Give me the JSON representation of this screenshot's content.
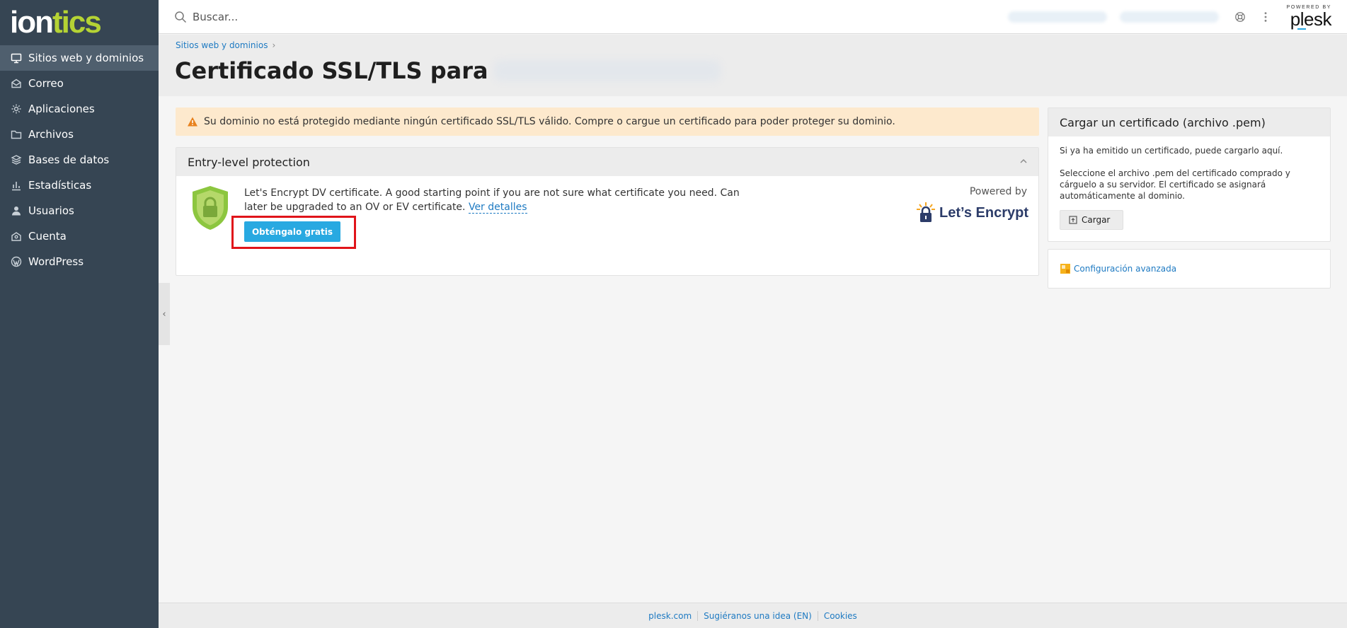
{
  "logo": {
    "part1": "ion",
    "part2": "tics"
  },
  "sidebar": {
    "items": [
      {
        "label": "Sitios web y dominios",
        "icon": "monitor-icon",
        "active": true
      },
      {
        "label": "Correo",
        "icon": "mail-icon"
      },
      {
        "label": "Aplicaciones",
        "icon": "gear-icon"
      },
      {
        "label": "Archivos",
        "icon": "folder-icon"
      },
      {
        "label": "Bases de datos",
        "icon": "database-icon"
      },
      {
        "label": "Estadísticas",
        "icon": "bar-chart-icon"
      },
      {
        "label": "Usuarios",
        "icon": "user-icon"
      },
      {
        "label": "Cuenta",
        "icon": "account-icon"
      },
      {
        "label": "WordPress",
        "icon": "wordpress-icon"
      }
    ],
    "collapse_glyph": "‹"
  },
  "topbar": {
    "search_placeholder": "Buscar...",
    "plesk_powered": "POWERED BY",
    "plesk_brand": "plesk"
  },
  "header": {
    "breadcrumb": "Sitios web y dominios",
    "breadcrumb_sep": "›",
    "title": "Certificado SSL/TLS para"
  },
  "warning": {
    "text": "Su dominio no está protegido mediante ningún certificado SSL/TLS válido. Compre o cargue un certificado para poder proteger su dominio."
  },
  "entry_panel": {
    "title": "Entry-level protection",
    "description": "Let's Encrypt DV certificate. A good starting point if you are not sure what certificate you need. Can later be upgraded to an OV or EV certificate.",
    "details_link": "Ver detalles",
    "button": "Obténgalo gratis",
    "powered_by": "Powered by",
    "provider": "Let’s Encrypt"
  },
  "upload_card": {
    "title": "Cargar un certificado (archivo .pem)",
    "text1": "Si ya ha emitido un certificado, puede cargarlo aquí.",
    "text2": "Seleccione el archivo .pem del certificado comprado y cárguelo a su servidor. El certificado se asignará automáticamente al dominio.",
    "button": "Cargar"
  },
  "advanced": {
    "link": "Configuración avanzada"
  },
  "footer": {
    "links": [
      "plesk.com",
      "Sugiéranos una idea (EN)",
      "Cookies"
    ]
  },
  "colors": {
    "sidebar_bg": "#364553",
    "accent": "#28a9e1",
    "link": "#1e7ac2",
    "warning_bg": "#fde9cd",
    "logo_green": "#b5d334",
    "highlight_red": "#e0141a"
  }
}
